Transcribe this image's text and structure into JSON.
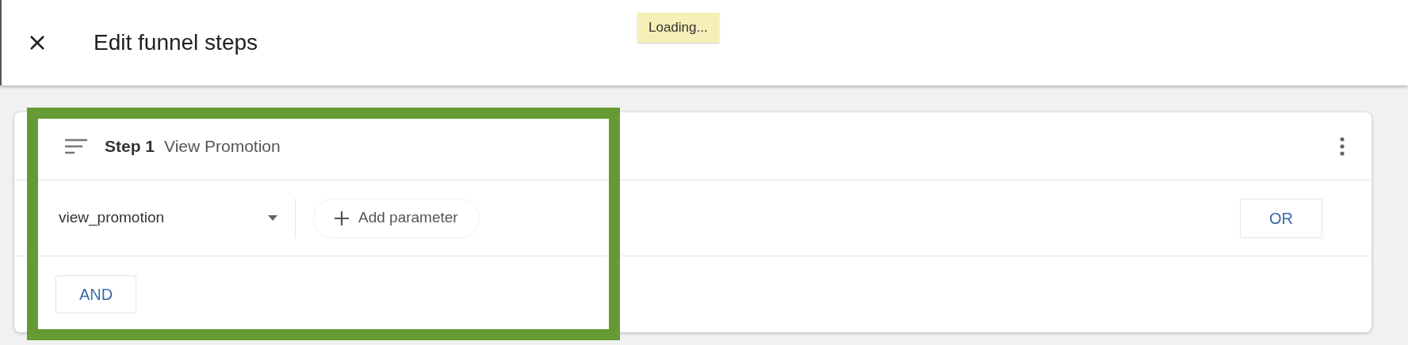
{
  "header": {
    "title": "Edit funnel steps",
    "toast": "Loading..."
  },
  "steps": [
    {
      "label": "Step 1",
      "name": "View Promotion",
      "event": "view_promotion",
      "add_parameter": "Add parameter",
      "or_button": "OR",
      "and_button": "AND"
    }
  ]
}
